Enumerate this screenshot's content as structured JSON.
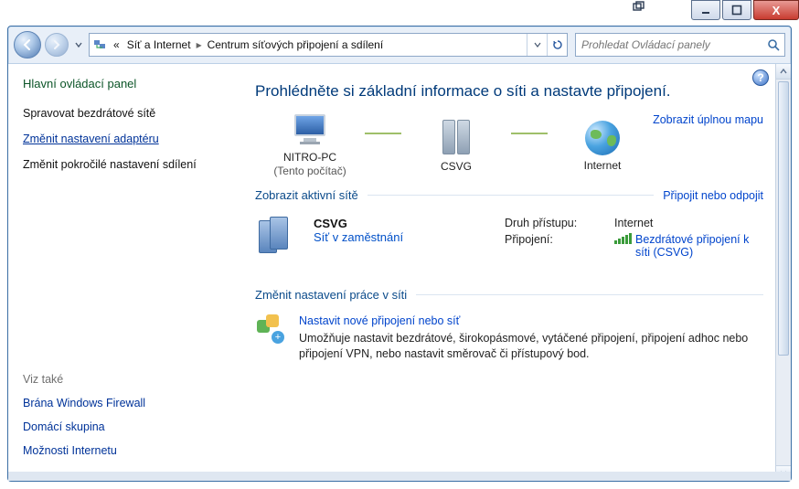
{
  "titlebar": {
    "close": "X"
  },
  "nav": {
    "crumb_root": "«",
    "crumb1": "Síť a Internet",
    "crumb2": "Centrum síťových připojení a sdílení"
  },
  "search": {
    "placeholder": "Prohledat Ovládací panely"
  },
  "sidebar": {
    "heading": "Hlavní ovládací panel",
    "link1": "Spravovat bezdrátové sítě",
    "link2": "Změnit nastavení adaptéru",
    "link3": "Změnit pokročilé nastavení sdílení",
    "seealso": "Viz také",
    "sa1": "Brána Windows Firewall",
    "sa2": "Domácí skupina",
    "sa3": "Možnosti Internetu"
  },
  "main": {
    "headline": "Prohlédněte si základní informace o síti a nastavte připojení.",
    "map": {
      "pc": "NITRO-PC",
      "pc_sub": "(Tento počítač)",
      "gw": "CSVG",
      "net": "Internet",
      "fullmap": "Zobrazit úplnou mapu"
    },
    "active": {
      "title": "Zobrazit aktivní sítě",
      "rlink": "Připojit nebo odpojit",
      "name": "CSVG",
      "type": "Síť v zaměstnání",
      "k1": "Druh přístupu:",
      "v1": "Internet",
      "k2": "Připojení:",
      "v2": "Bezdrátové připojení k síti (CSVG)"
    },
    "change": {
      "title": "Změnit nastavení práce v síti",
      "task1_title": "Nastavit nové připojení nebo síť",
      "task1_desc": "Umožňuje nastavit bezdrátové, širokopásmové, vytáčené připojení, připojení adhoc nebo připojení VPN, nebo nastavit směrovač či přístupový bod."
    }
  }
}
